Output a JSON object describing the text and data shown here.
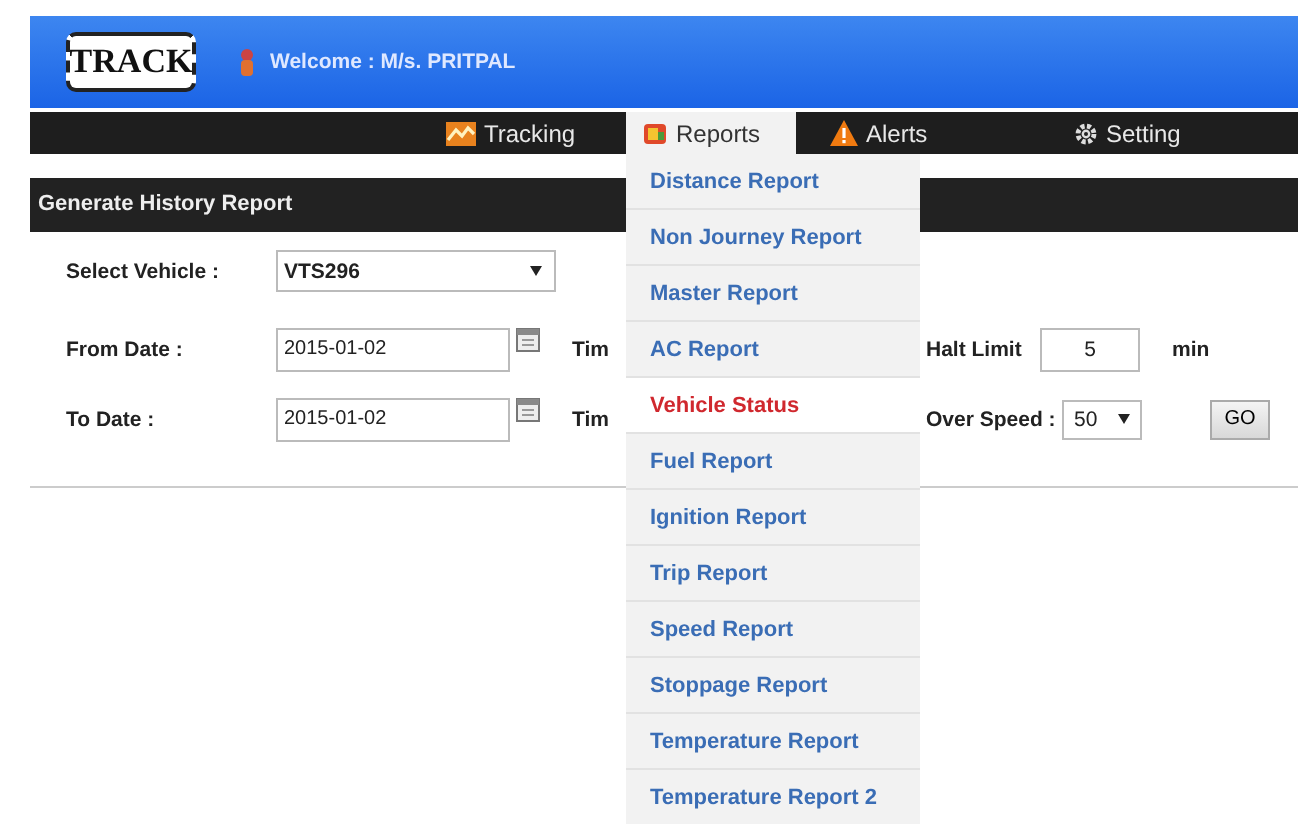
{
  "header": {
    "logo": "TRACK",
    "welcome": "Welcome : M/s. PRITPAL"
  },
  "nav": [
    {
      "label": "Tracking",
      "selected": false
    },
    {
      "label": "Reports",
      "selected": true
    },
    {
      "label": "Alerts",
      "selected": false
    },
    {
      "label": "Setting",
      "selected": false
    }
  ],
  "reports_menu": [
    {
      "label": "Distance Report",
      "selected": false
    },
    {
      "label": "Non Journey Report",
      "selected": false
    },
    {
      "label": "Master Report",
      "selected": false
    },
    {
      "label": "AC Report",
      "selected": false
    },
    {
      "label": "Vehicle Status",
      "selected": true
    },
    {
      "label": "Fuel Report",
      "selected": false
    },
    {
      "label": "Ignition Report",
      "selected": false
    },
    {
      "label": "Trip Report",
      "selected": false
    },
    {
      "label": "Speed Report",
      "selected": false
    },
    {
      "label": "Stoppage Report",
      "selected": false
    },
    {
      "label": "Temperature Report",
      "selected": false
    },
    {
      "label": "Temperature Report 2",
      "selected": false
    }
  ],
  "panel": {
    "title": "Generate History Report",
    "vehicle": {
      "label": "Select Vehicle :",
      "value": "VTS296"
    },
    "from_date": {
      "label": "From Date :",
      "value": "2015-01-02",
      "time_label": "Tim"
    },
    "to_date": {
      "label": "To Date :",
      "value": "2015-01-02",
      "time_label": "Tim"
    },
    "halt_limit": {
      "label": "Halt Limit",
      "value": "5",
      "unit": "min"
    },
    "over_speed": {
      "label": "Over Speed :",
      "value": "50"
    },
    "go": "GO"
  }
}
